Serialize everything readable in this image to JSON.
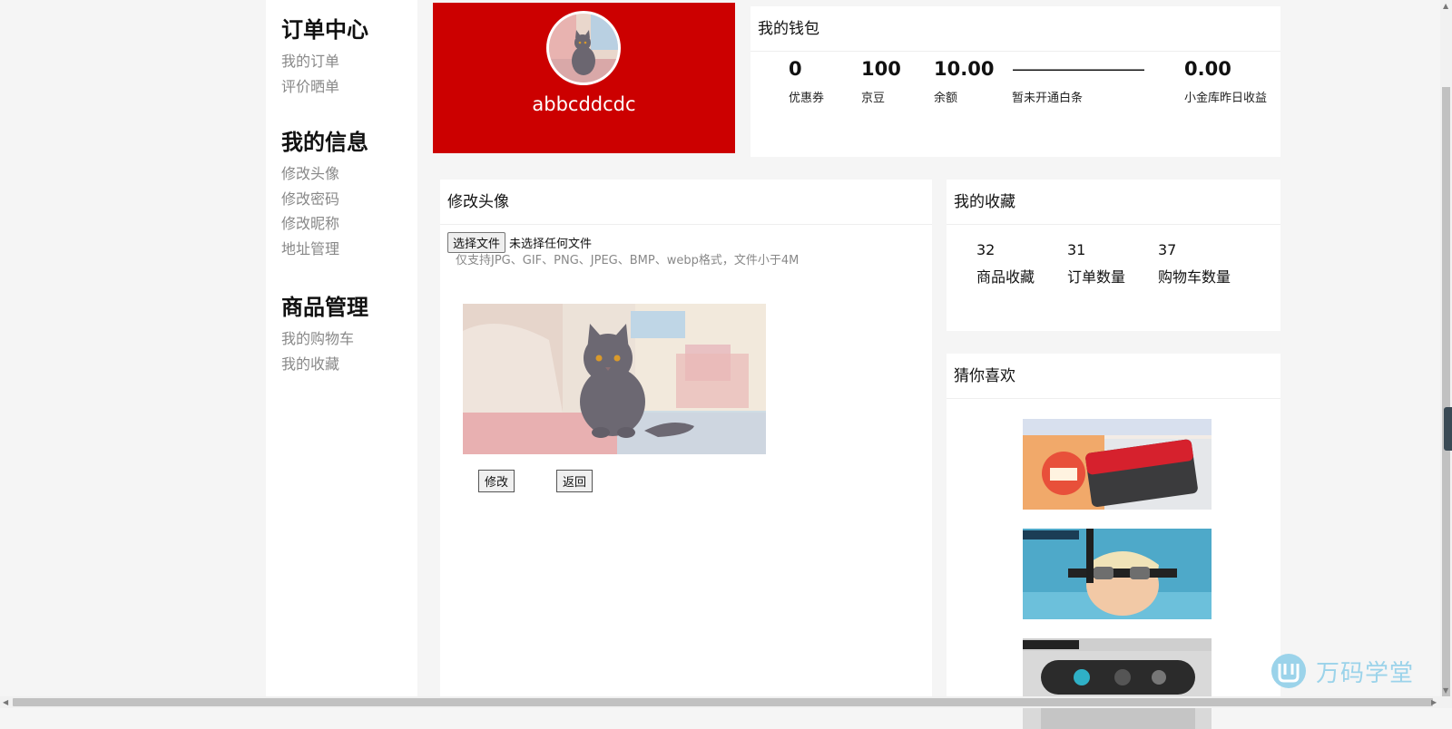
{
  "sidebar": {
    "groups": [
      {
        "title": "订单中心",
        "items": [
          "我的订单",
          "评价晒单"
        ]
      },
      {
        "title": "我的信息",
        "items": [
          "修改头像",
          "修改密码",
          "修改昵称",
          "地址管理"
        ]
      },
      {
        "title": "商品管理",
        "items": [
          "我的购物车",
          "我的收藏"
        ]
      }
    ]
  },
  "profile": {
    "username": "abbcddcdc",
    "banner_color": "#cc0000"
  },
  "wallet": {
    "title": "我的钱包",
    "items": [
      {
        "value": "0",
        "label": "优惠券"
      },
      {
        "value": "100",
        "label": "京豆"
      },
      {
        "value": "10.00",
        "label": "余额"
      },
      {
        "value": "————————",
        "label": "暂未开通白条"
      },
      {
        "value": "0.00",
        "label": "小金库昨日收益"
      }
    ]
  },
  "upload": {
    "title": "修改头像",
    "choose_file_label": "选择文件",
    "file_status": "未选择任何文件",
    "hint": "仅支持JPG、GIF、PNG、JPEG、BMP、webp格式，文件小于4M",
    "submit_label": "修改",
    "back_label": "返回"
  },
  "favorites": {
    "title": "我的收藏",
    "items": [
      {
        "value": "32",
        "label": "商品收藏"
      },
      {
        "value": "31",
        "label": "订单数量"
      },
      {
        "value": "37",
        "label": "购物车数量"
      }
    ]
  },
  "guess": {
    "title": "猜你喜欢",
    "products": [
      {
        "icon": "sd-card-product-image"
      },
      {
        "icon": "swim-goggles-product-image"
      },
      {
        "icon": "swim-earbuds-product-image"
      }
    ]
  },
  "watermark": {
    "text": "万码学堂",
    "color": "#9bd3ea"
  }
}
